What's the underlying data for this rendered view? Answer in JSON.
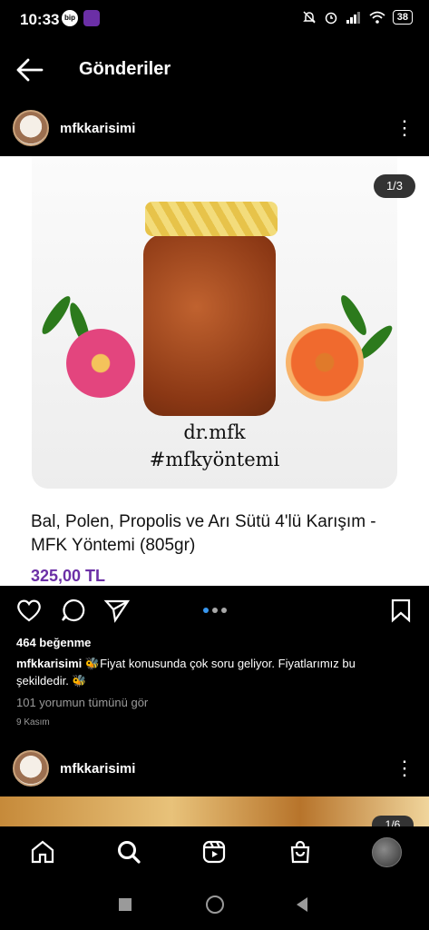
{
  "status_bar": {
    "time": "10:33",
    "app_icon_1": "bip",
    "battery": "38"
  },
  "header": {
    "title": "Gönderiler"
  },
  "post1": {
    "username": "mfkkarisimi",
    "counter": "1/3",
    "photo_text_1": "dr.mfk",
    "photo_text_2": "#mfkyöntemi",
    "product_title": "Bal, Polen, Propolis ve Arı Sütü 4'lü Karışım - MFK Yöntemi (805gr)",
    "price": "325,00 TL",
    "likes": "464 beğenme",
    "caption_user": "mfkkarisimi",
    "caption_text": "🐝Fiyat konusunda çok soru geliyor. Fiyatlarımız bu şekildedir. 🐝",
    "comments_link": "101 yorumun tümünü gör",
    "date": "9 Kasım"
  },
  "post2": {
    "username": "mfkkarisimi",
    "counter": "1/6"
  },
  "colors": {
    "price": "#6b2fa6",
    "active_dot": "#3897f0",
    "inactive_dot": "#a8a8a8"
  },
  "icons": [
    "back-arrow-icon",
    "more-icon",
    "heart-icon",
    "comment-icon",
    "share-icon",
    "bookmark-icon",
    "home-icon",
    "search-icon",
    "reels-icon",
    "shop-icon",
    "profile-avatar"
  ]
}
